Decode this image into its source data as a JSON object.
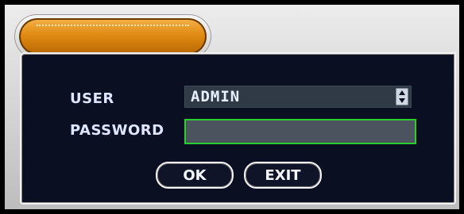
{
  "login": {
    "user_label": "USER",
    "user_value": "ADMIN",
    "password_label": "PASSWORD",
    "password_value": "",
    "ok_label": "OK",
    "exit_label": "EXIT"
  },
  "colors": {
    "panel_bg": "#0b0f22",
    "frame_bg": "#d7d7d7",
    "tab_orange": "#e08b12",
    "label_text": "#dfe6ff",
    "select_bg": "#2f3a46",
    "password_bg": "#4b545e",
    "password_border": "#2bcf2b"
  },
  "icons": {
    "tab": "tab-icon",
    "spinner": "spinner-icon",
    "spinner_up": "chevron-up-icon",
    "spinner_down": "chevron-down-icon"
  }
}
